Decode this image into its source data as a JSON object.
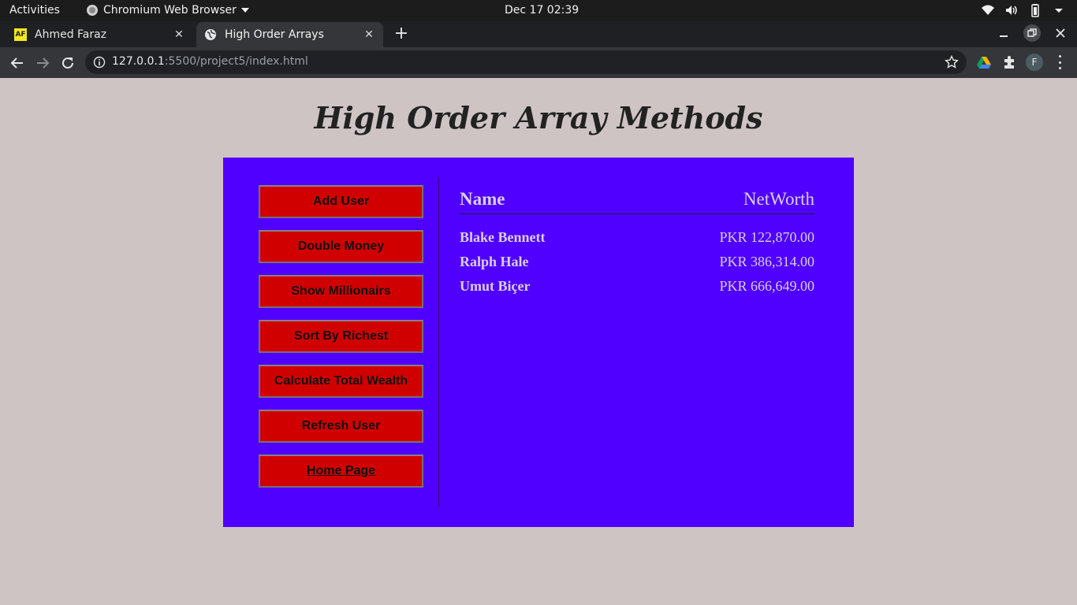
{
  "system": {
    "activities": "Activities",
    "app_name": "Chromium Web Browser",
    "clock": "Dec 17  02:39"
  },
  "browser": {
    "tabs": [
      {
        "favicon": "AF",
        "title": "Ahmed Faraz",
        "active": false
      },
      {
        "favicon": "globe-icon",
        "title": "High Order Arrays",
        "active": true
      }
    ],
    "address": {
      "host": "127.0.0.1",
      "rest": ":5500/project5/index.html"
    },
    "profile_initial": "F"
  },
  "page": {
    "title": "High Order Array Methods",
    "buttons": [
      "Add User",
      "Double Money",
      "Show Millionairs",
      "Sort By Richest",
      "Calculate Total Wealth",
      "Refresh User",
      "Home Page"
    ],
    "table": {
      "headers": {
        "name": "Name",
        "worth": "NetWorth"
      },
      "rows": [
        {
          "name": "Blake Bennett",
          "worth": "PKR 122,870.00"
        },
        {
          "name": "Ralph Hale",
          "worth": "PKR 386,314.00"
        },
        {
          "name": "Umut Biçer",
          "worth": "PKR 666,649.00"
        }
      ]
    }
  },
  "colors": {
    "page_bg": "#cfc4c4",
    "panel_bg": "#5000ff",
    "button_bg": "#d10000",
    "text_light": "#d9cfe6"
  }
}
